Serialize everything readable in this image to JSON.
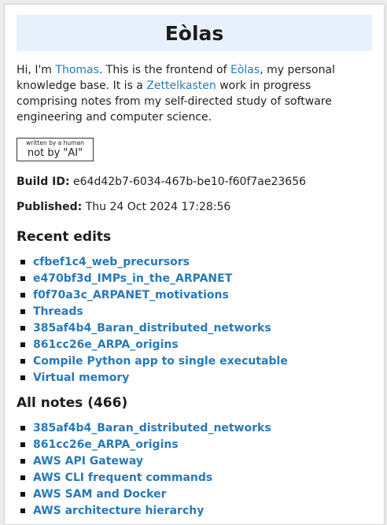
{
  "header": {
    "title": "Eòlas"
  },
  "intro": {
    "prefix": "Hi, I'm ",
    "name_link": "Thomas",
    "mid": ". This is the frontend of ",
    "site_link": "Eòlas",
    "mid2": ", my personal knowledge base. It is a ",
    "zk_link": "Zettelkasten",
    "suffix": " work in progress comprising notes from my self-directed study of software engineering and computer science."
  },
  "badge": {
    "line1": "written by a human",
    "line2": "not by \"AI\""
  },
  "build": {
    "label": "Build ID:",
    "value": "e64d42b7-6034-467b-be10-f60f7ae23656"
  },
  "published": {
    "label": "Published:",
    "value": "Thu 24 Oct 2024 17:28:56"
  },
  "recent": {
    "heading": "Recent edits",
    "items": [
      "cfbef1c4_web_precursors",
      "e470bf3d_IMPs_in_the_ARPANET",
      "f0f70a3c_ARPANET_motivations",
      "Threads",
      "385af4b4_Baran_distributed_networks",
      "861cc26e_ARPA_origins",
      "Compile Python app to single executable",
      "Virtual memory"
    ]
  },
  "all": {
    "heading": "All notes (466)",
    "items": [
      "385af4b4_Baran_distributed_networks",
      "861cc26e_ARPA_origins",
      "AWS API Gateway",
      "AWS CLI frequent commands",
      "AWS SAM and Docker",
      "AWS architecture hierarchy"
    ]
  },
  "colors": {
    "link": "#2879b8",
    "title_bg": "#e7f1fb",
    "page_bg": "#ececec"
  }
}
